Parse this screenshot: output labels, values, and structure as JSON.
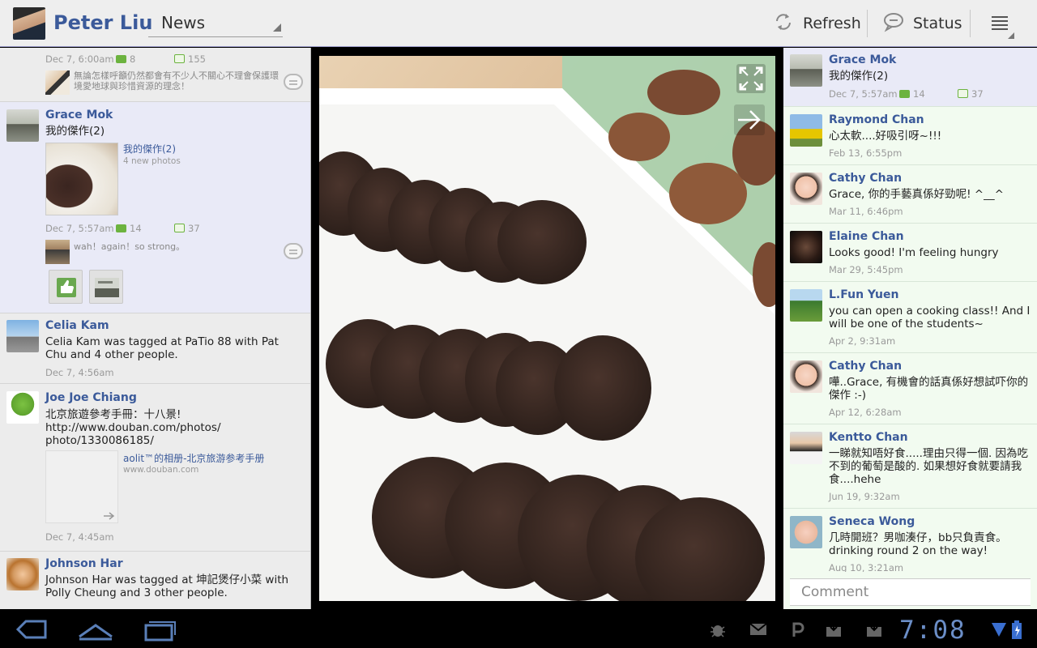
{
  "header": {
    "username": "Peter Liu",
    "view_select": "News",
    "refresh_label": "Refresh",
    "status_label": "Status"
  },
  "feed": {
    "posts": [
      {
        "time": "Dec 7, 6:00am",
        "comments": "8",
        "likes": "155",
        "comment_preview": "無論怎樣呼籲仍然都會有不少人不關心不理會保護環境愛地球與珍惜資源的理念！"
      },
      {
        "name": "Grace Mok",
        "text": "我的傑作(2)",
        "album_title": "我的傑作(2)",
        "album_sub": "4 new photos",
        "time": "Dec 7, 5:57am",
        "comments": "14",
        "likes": "37",
        "comment_preview": "wah！again！so strong。"
      },
      {
        "name": "Celia Kam",
        "text": "Celia Kam was tagged at PaTio 88 with Pat Chu and 4 other people.",
        "time": "Dec 7, 4:56am"
      },
      {
        "name": "Joe Joe Chiang",
        "text": "北京旅遊參考手冊：十八景!\nhttp://www.douban.com/photos/\nphoto/1330086185/",
        "link_title": "aolit™的相册-北京旅游参考手册",
        "link_sub": "www.douban.com",
        "time": "Dec 7, 4:45am"
      },
      {
        "name": "Johnson Har",
        "text": "Johnson Har was tagged at 坤記煲仔小菜 with Polly Cheung and 3 other people."
      }
    ]
  },
  "detail": {
    "owner": {
      "name": "Grace Mok",
      "text": "我的傑作(2)",
      "time": "Dec 7, 5:57am",
      "comments": "14",
      "likes": "37"
    },
    "comments": [
      {
        "name": "Raymond Chan",
        "text": "心太軟....好吸引呀~!!!",
        "time": "Feb 13, 6:55pm"
      },
      {
        "name": "Cathy Chan",
        "text": "Grace, 你的手藝真係好勁呢! ^__^",
        "time": "Mar 11, 6:46pm"
      },
      {
        "name": "Elaine Chan",
        "text": "Looks good! I'm feeling hungry",
        "time": "Mar 29, 5:45pm"
      },
      {
        "name": "L.Fun Yuen",
        "text": "you can open a cooking class!! And I will be one of the students~",
        "time": "Apr 2, 9:31am"
      },
      {
        "name": "Cathy Chan",
        "text": "嘩..Grace, 有機會的話真係好想試吓你的傑作 :-)",
        "time": "Apr 12, 6:28am"
      },
      {
        "name": "Kentto Chan",
        "text": "一睇就知唔好食.....理由只得一個. 因為吃不到的葡萄是酸的. 如果想好食就要請我食....hehe",
        "time": "Jun 19, 9:32am"
      },
      {
        "name": "Seneca Wong",
        "text": "几時開班？男咖湊仔，bb只負責食。drinking round 2 on the way!",
        "time": "Aug 10, 3:21am"
      }
    ],
    "comment_placeholder": "Comment"
  },
  "system": {
    "clock": "7:08"
  },
  "colors": {
    "accent": "#3b5a9a",
    "count_icon": "#6cb33f",
    "clock": "#6b8ec7"
  }
}
